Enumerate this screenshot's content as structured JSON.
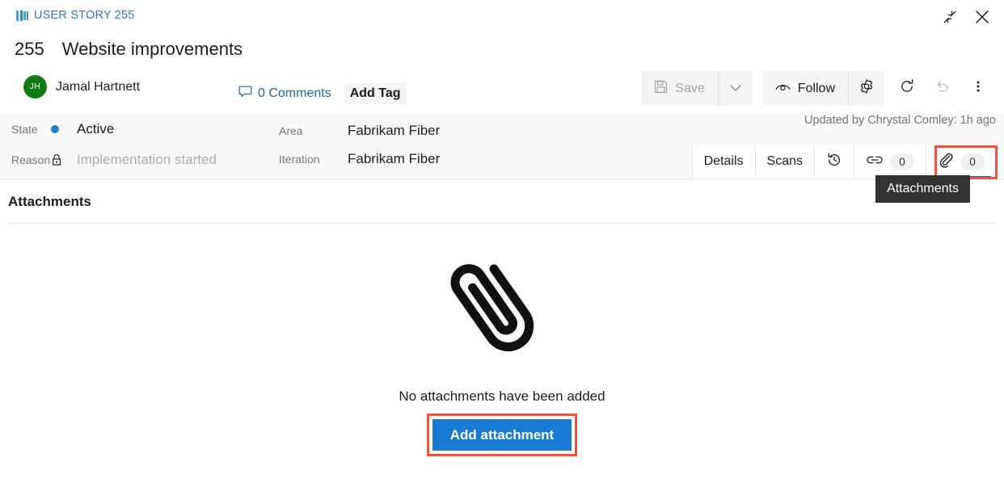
{
  "window": {
    "work_item_type": "USER STORY 255",
    "type_icon": "user-story-icon",
    "restore_icon": "restore-window-icon",
    "close_icon": "close-icon"
  },
  "header": {
    "id": "255",
    "title": "Website improvements",
    "assignee": {
      "initials": "JH",
      "name": "Jamal Hartnett",
      "avatar_color": "#107c10"
    },
    "comments_label": "0 Comments",
    "comments_icon": "comment-icon",
    "add_tag_label": "Add Tag"
  },
  "toolbar": {
    "save_label": "Save",
    "save_icon": "save-disk-icon",
    "save_dropdown_icon": "chevron-down-icon",
    "follow_label": "Follow",
    "follow_icon": "eye-icon",
    "settings_icon": "gear-icon",
    "refresh_icon": "refresh-icon",
    "undo_icon": "undo-icon",
    "more_icon": "more-vertical-icon"
  },
  "fields": [
    {
      "label": "State",
      "value": "Active",
      "icon": "state-dot",
      "dim": false
    },
    {
      "label": "Reason",
      "value": "Implementation started",
      "icon": "lock-icon",
      "dim": true
    },
    {
      "label": "Area",
      "value": "Fabrikam Fiber",
      "icon": "",
      "dim": false
    },
    {
      "label": "Iteration",
      "value": "Fabrikam Fiber",
      "icon": "",
      "dim": false
    }
  ],
  "updated_by": "Updated by Chrystal Comley: 1h ago",
  "tabs": [
    {
      "label": "Details",
      "icon": "",
      "count": "",
      "active": false
    },
    {
      "label": "Scans",
      "icon": "",
      "count": "",
      "active": false
    },
    {
      "label": "",
      "icon": "history-icon",
      "count": "",
      "active": false
    },
    {
      "label": "",
      "icon": "link-icon",
      "count": "0",
      "active": false
    },
    {
      "label": "",
      "icon": "paperclip-icon",
      "count": "0",
      "active": true
    }
  ],
  "tooltip": {
    "text": "Attachments"
  },
  "content": {
    "section_title": "Attachments",
    "empty_icon": "paperclip-illustration",
    "empty_text": "No attachments have been added",
    "add_button_label": "Add attachment"
  },
  "colors": {
    "accent_bar": "#1f9ac9",
    "primary_button": "#1a7bd4",
    "highlight_ring": "#f4503c",
    "active_tab_underline": "#0a6fd0",
    "state_dot": "#1f7fd3",
    "link_text": "#21699e",
    "tooltip_bg": "#333333"
  }
}
